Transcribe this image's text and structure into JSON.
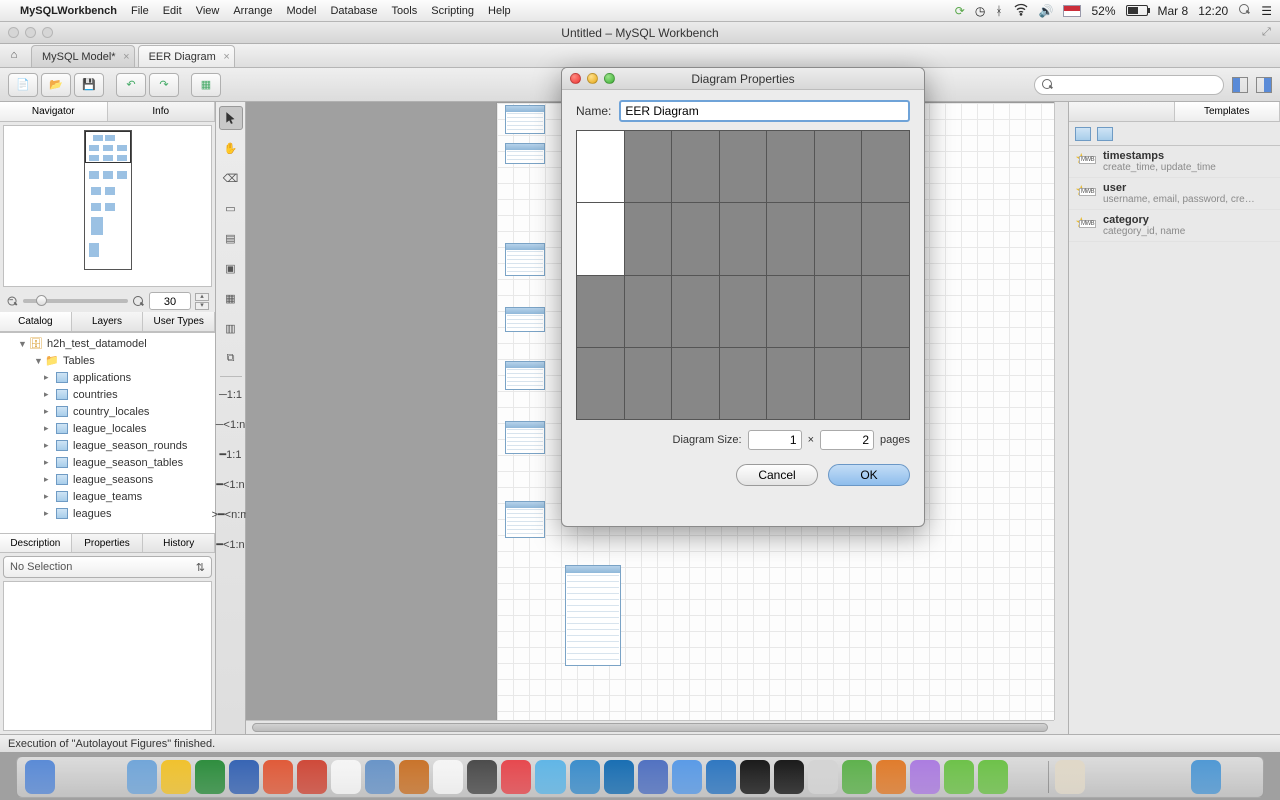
{
  "menubar": {
    "app": "MySQLWorkbench",
    "items": [
      "File",
      "Edit",
      "View",
      "Arrange",
      "Model",
      "Database",
      "Tools",
      "Scripting",
      "Help"
    ],
    "right": {
      "battery": "52%",
      "date": "Mar 8",
      "time": "12:20"
    }
  },
  "window": {
    "title": "Untitled – MySQL Workbench"
  },
  "doc_tabs": [
    {
      "label": "MySQL Model*",
      "active": false
    },
    {
      "label": "EER Diagram",
      "active": true
    }
  ],
  "toolbar": {
    "search_placeholder": ""
  },
  "left": {
    "tabs_top": [
      "Navigator",
      "Info"
    ],
    "zoom": "30",
    "tabs_mid": [
      "Catalog",
      "Layers",
      "User Types"
    ],
    "db": "h2h_test_datamodel",
    "tables_label": "Tables",
    "tables": [
      "applications",
      "countries",
      "country_locales",
      "league_locales",
      "league_season_rounds",
      "league_season_tables",
      "league_seasons",
      "league_teams",
      "leagues"
    ],
    "tabs_bottom": [
      "Description",
      "Properties",
      "History"
    ],
    "selection": "No Selection"
  },
  "palette_rel": [
    "1:1",
    "1:n",
    "1:1",
    "1:n",
    "n:m",
    "1:n"
  ],
  "right": {
    "tab": "Templates",
    "templates": [
      {
        "title": "timestamps",
        "sub": "create_time, update_time"
      },
      {
        "title": "user",
        "sub": "username, email, password, cre…"
      },
      {
        "title": "category",
        "sub": "category_id, name"
      }
    ]
  },
  "status": "Execution of \"Autolayout Figures\" finished.",
  "dialog": {
    "title": "Diagram Properties",
    "name_label": "Name:",
    "name_value": "EER Diagram",
    "size_label": "Diagram Size:",
    "w": "1",
    "h": "2",
    "pages": "pages",
    "cancel": "Cancel",
    "ok": "OK"
  },
  "dock_colors": [
    "#5b8bd6",
    "#777",
    "#666",
    "#72a6d9",
    "#f0c22e",
    "#2f8e3f",
    "#3865b4",
    "#e05b3a",
    "#cf4a3a",
    "#f5f5f5",
    "#6a95c8",
    "#c9742b",
    "#f5f5f5",
    "#4c4c4c",
    "#e6494f",
    "#61b6e6",
    "#3d8ecb",
    "#1a6fb3",
    "#5272c1",
    "#5b9be6",
    "#3078c1",
    "#1b1b1b",
    "#1b1b1b",
    "#d4d4d4",
    "#5fb24e",
    "#e07c2c",
    "#ac7de0",
    "#6ec24a",
    "#6ec24a",
    "#444",
    "#e0d8c8",
    "#bbb",
    "#555",
    "#333",
    "#5199d4",
    "#555"
  ]
}
